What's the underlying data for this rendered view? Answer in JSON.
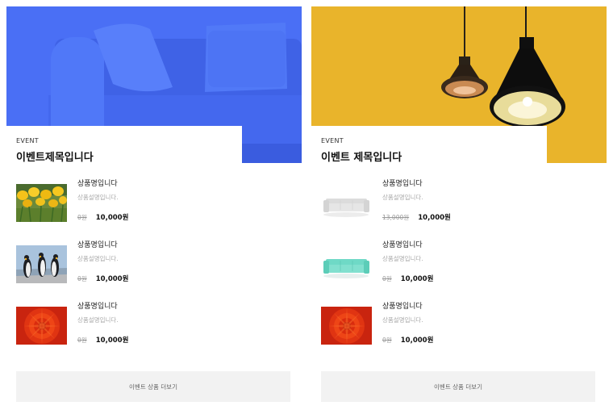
{
  "events": [
    {
      "label": "EVENT",
      "title": "이벤트제목입니다",
      "banner_image": "blue-sofa",
      "products": [
        {
          "image": "yellow-tulips",
          "name": "상품명입니다",
          "description": "상품설명입니다.",
          "original_price": "0원",
          "sale_price": "10,000원"
        },
        {
          "image": "penguins",
          "name": "상품명입니다",
          "description": "상품설명입니다.",
          "original_price": "0원",
          "sale_price": "10,000원"
        },
        {
          "image": "red-chrysanthemum",
          "name": "상품명입니다",
          "description": "상품설명입니다.",
          "original_price": "0원",
          "sale_price": "10,000원"
        }
      ],
      "more_label": "이벤트 상품 더보기"
    },
    {
      "label": "EVENT",
      "title": "이벤트 제목입니다",
      "banner_image": "pendant-lamps",
      "products": [
        {
          "image": "white-sofa",
          "name": "상품명입니다",
          "description": "상품설명입니다.",
          "original_price": "13,000원",
          "sale_price": "10,000원"
        },
        {
          "image": "mint-sofa",
          "name": "상품명입니다",
          "description": "상품설명입니다.",
          "original_price": "0원",
          "sale_price": "10,000원"
        },
        {
          "image": "red-chrysanthemum",
          "name": "상품명입니다",
          "description": "상품설명입니다.",
          "original_price": "0원",
          "sale_price": "10,000원"
        }
      ],
      "more_label": "이벤트 상품 더보기"
    }
  ],
  "colors": {
    "blue_banner": "#4a6ff5",
    "yellow_banner": "#e9b42b",
    "button_bg": "#f2f2f2"
  }
}
